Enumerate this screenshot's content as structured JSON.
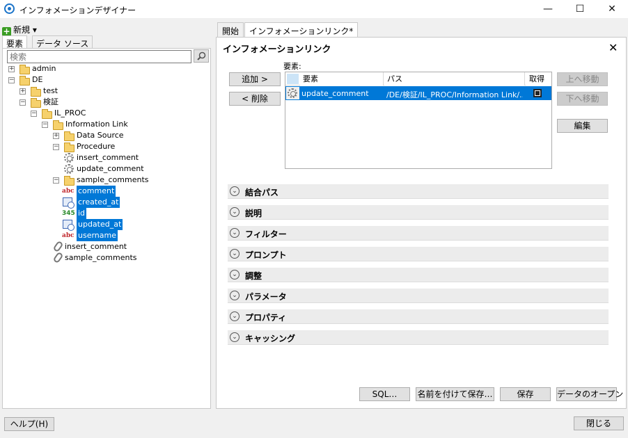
{
  "window": {
    "title": "インフォメーションデザイナー",
    "minimize": "—",
    "maximize": "☐",
    "close": "✕"
  },
  "left": {
    "new_label": "新規 ▾",
    "tabs": [
      "要素",
      "データ ソース"
    ],
    "search_placeholder": "検索",
    "tree": [
      {
        "label": "admin",
        "icon": "folder-icon",
        "exp": "+"
      },
      {
        "label": "DE",
        "icon": "folder-icon",
        "exp": "−"
      },
      {
        "label": "test",
        "icon": "folder-icon",
        "exp": "+"
      },
      {
        "label": "検証",
        "icon": "folder-icon",
        "exp": "−"
      },
      {
        "label": "IL_PROC",
        "icon": "folder-icon",
        "exp": "−"
      },
      {
        "label": "Information Link",
        "icon": "folder-icon",
        "exp": "−"
      },
      {
        "label": "Data Source",
        "icon": "folder-icon",
        "exp": "+"
      },
      {
        "label": "Procedure",
        "icon": "folder-icon",
        "exp": "−"
      },
      {
        "label": "insert_comment",
        "icon": "gear-icon"
      },
      {
        "label": "update_comment",
        "icon": "gear-icon"
      },
      {
        "label": "sample_comments",
        "icon": "folder-icon",
        "exp": "−"
      },
      {
        "label": "comment",
        "icon": "string-column-icon",
        "selected": true
      },
      {
        "label": "created_at",
        "icon": "datetime-column-icon",
        "selected": true
      },
      {
        "label": "id",
        "icon": "numeric-column-icon",
        "selected": true
      },
      {
        "label": "updated_at",
        "icon": "datetime-column-icon",
        "selected": true
      },
      {
        "label": "username",
        "icon": "string-column-icon",
        "selected": true
      },
      {
        "label": "insert_comment",
        "icon": "link-icon"
      },
      {
        "label": "sample_comments",
        "icon": "link-icon"
      }
    ],
    "help_button": "ヘルプ(H)"
  },
  "right": {
    "tabs": [
      "開始",
      "インフォメーションリンク*"
    ],
    "title": "インフォメーションリンク",
    "add_button": "追加 >",
    "remove_button": "< 削除",
    "elements_label": "要素:",
    "grid_headers": [
      "要素",
      "パス",
      "取得"
    ],
    "grid_rows": [
      {
        "element": "update_comment",
        "path": "/DE/検証/IL_PROC/Information Link/...",
        "fetch": true
      }
    ],
    "move_up": "上へ移動",
    "move_down": "下へ移動",
    "edit": "編集",
    "sections": [
      "結合パス",
      "説明",
      "フィルター",
      "プロンプト",
      "調整",
      "パラメータ",
      "プロパティ",
      "キャッシング"
    ],
    "sql_button": "SQL…",
    "save_as_button": "名前を付けて保存…",
    "save_button": "保存",
    "open_data_button": "データのオープン",
    "close_button": "閉じる"
  },
  "colors": {
    "selection": "#0078d7",
    "folder": "#f6d16c",
    "accent": "#1a73c9"
  }
}
